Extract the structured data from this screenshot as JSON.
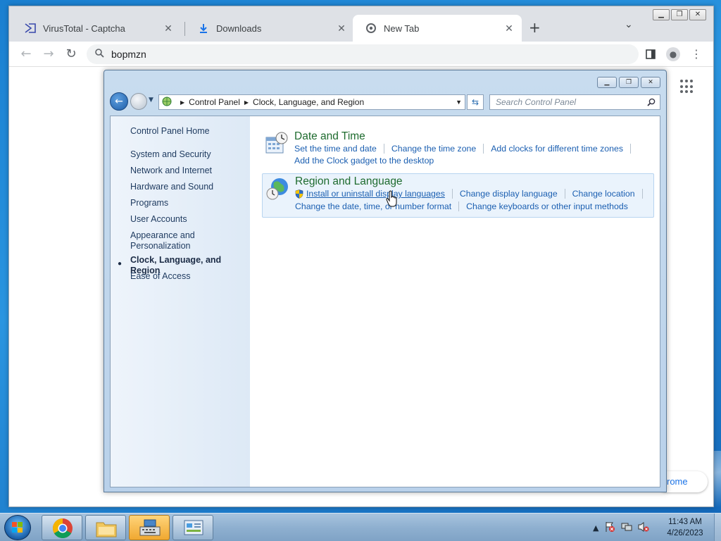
{
  "browser": {
    "tabs": [
      {
        "label": "VirusTotal - Captcha",
        "icon": "virustotal-icon"
      },
      {
        "label": "Downloads",
        "icon": "download-icon"
      },
      {
        "label": "New Tab",
        "icon": "chrome-icon"
      }
    ],
    "omnibox_value": "bopmzn",
    "bottom_pill_text": "rome"
  },
  "control_panel": {
    "breadcrumb": [
      "Control Panel",
      "Clock, Language, and Region"
    ],
    "search_placeholder": "Search Control Panel",
    "sidebar": {
      "home": "Control Panel Home",
      "items": [
        "System and Security",
        "Network and Internet",
        "Hardware and Sound",
        "Programs",
        "User Accounts",
        "Appearance and Personalization",
        "Clock, Language, and Region",
        "Ease of Access"
      ],
      "current_index": 6
    },
    "categories": [
      {
        "title": "Date and Time",
        "links": [
          "Set the time and date",
          "Change the time zone",
          "Add clocks for different time zones",
          "Add the Clock gadget to the desktop"
        ]
      },
      {
        "title": "Region and Language",
        "links": [
          "Install or uninstall display languages",
          "Change display language",
          "Change location",
          "Change the date, time, or number format",
          "Change keyboards or other input methods"
        ]
      }
    ]
  },
  "taskbar": {
    "time": "11:43 AM",
    "date": "4/26/2023"
  }
}
